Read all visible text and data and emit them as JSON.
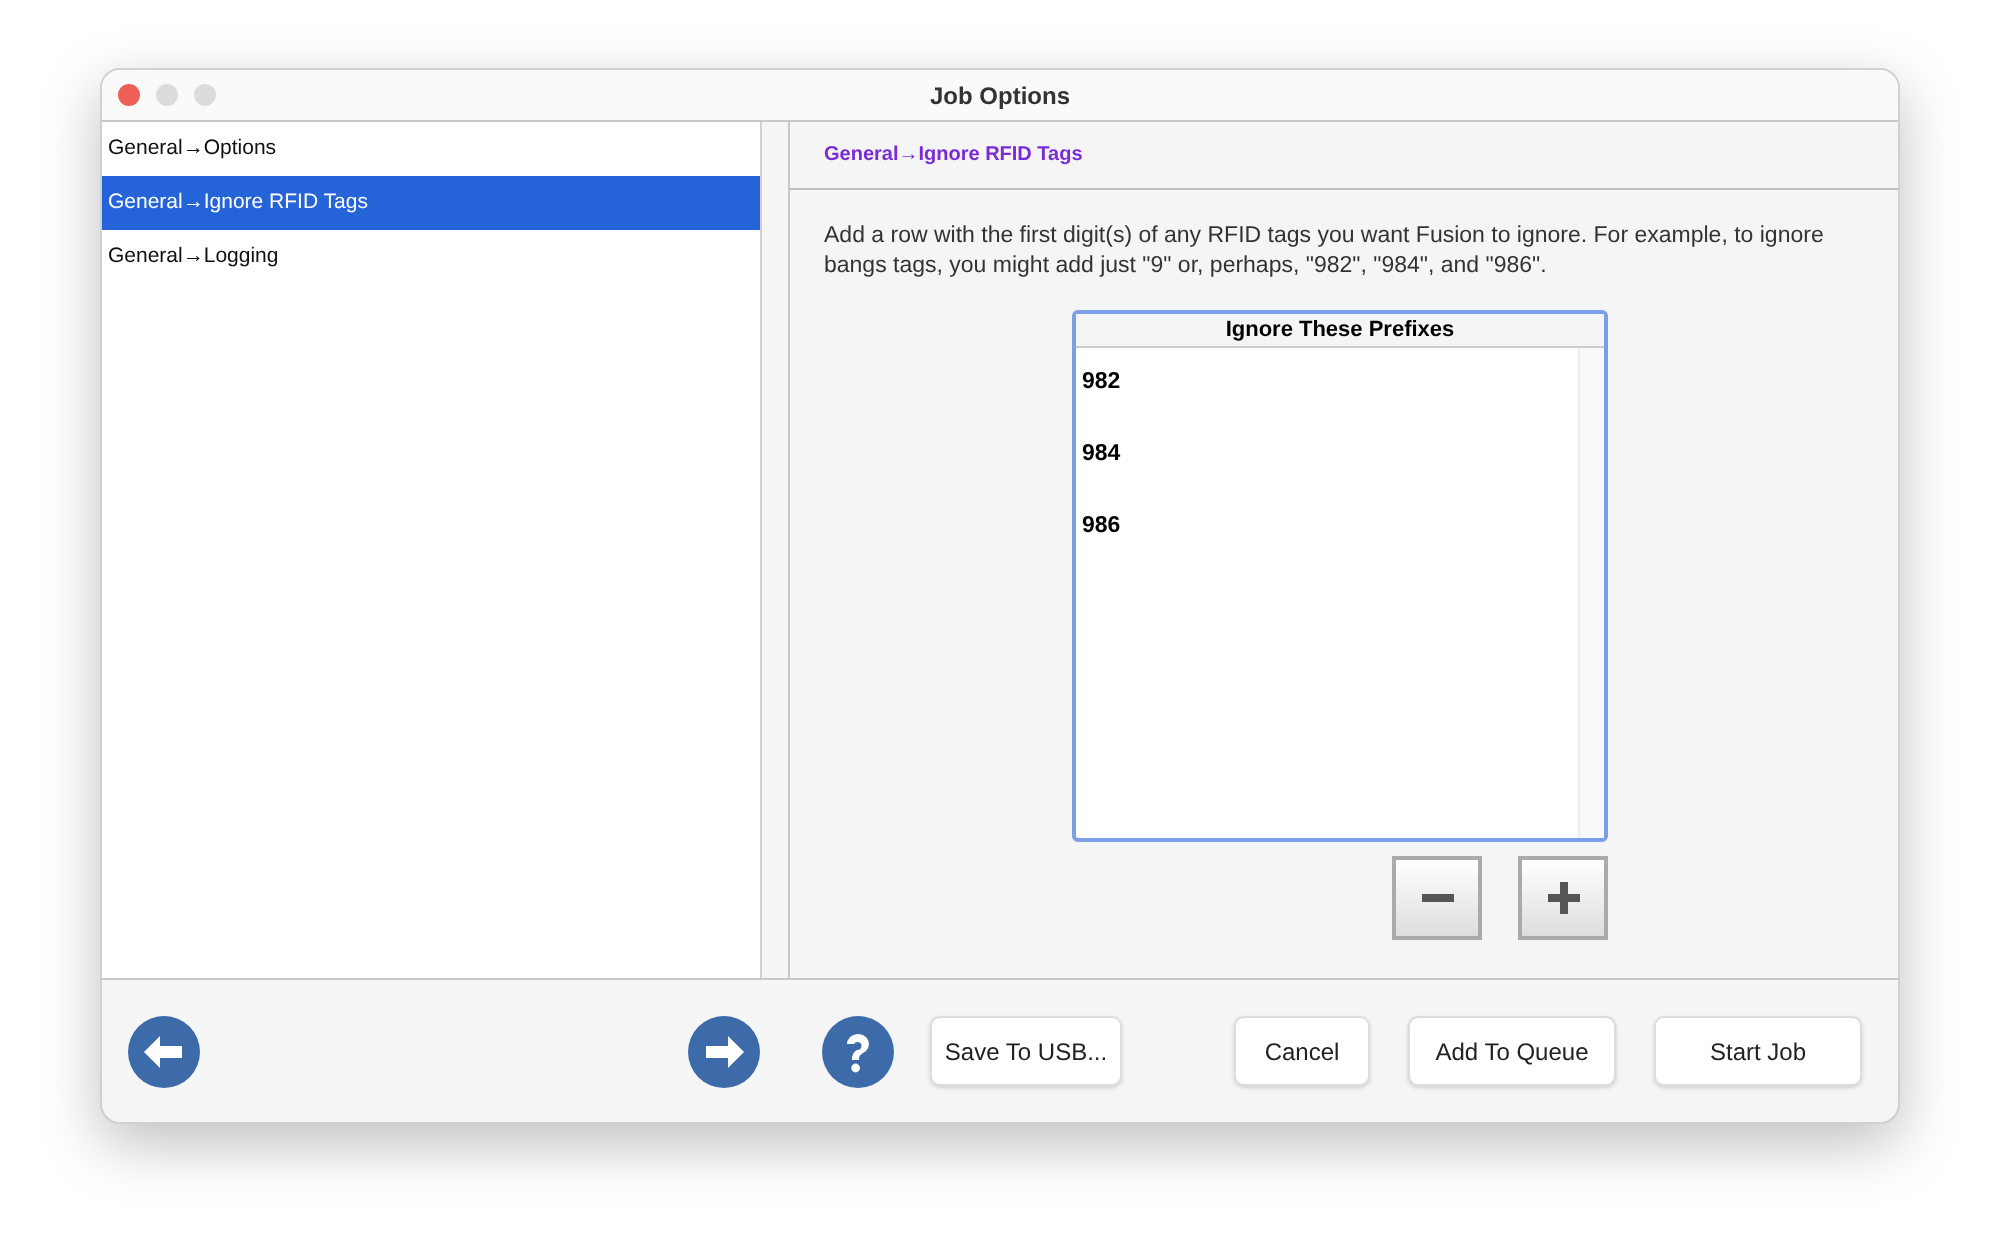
{
  "window": {
    "title": "Job Options"
  },
  "sidebar": {
    "items": [
      {
        "label": "General→Options",
        "selected": false
      },
      {
        "label": "General→Ignore RFID Tags",
        "selected": true
      },
      {
        "label": "General→Logging",
        "selected": false
      }
    ]
  },
  "panel": {
    "heading": "General→Ignore RFID Tags",
    "description": "Add a row with the first digit(s) of any RFID tags you want Fusion to ignore. For example, to ignore bangs tags, you might add just \"9\" or, perhaps, \"982\", \"984\", and \"986\".",
    "table": {
      "columns": [
        "Ignore These Prefixes"
      ],
      "rows": [
        "982",
        "984",
        "986"
      ]
    }
  },
  "footer": {
    "buttons": [
      "Save To USB...",
      "Cancel",
      "Add To Queue",
      "Start Job"
    ]
  }
}
